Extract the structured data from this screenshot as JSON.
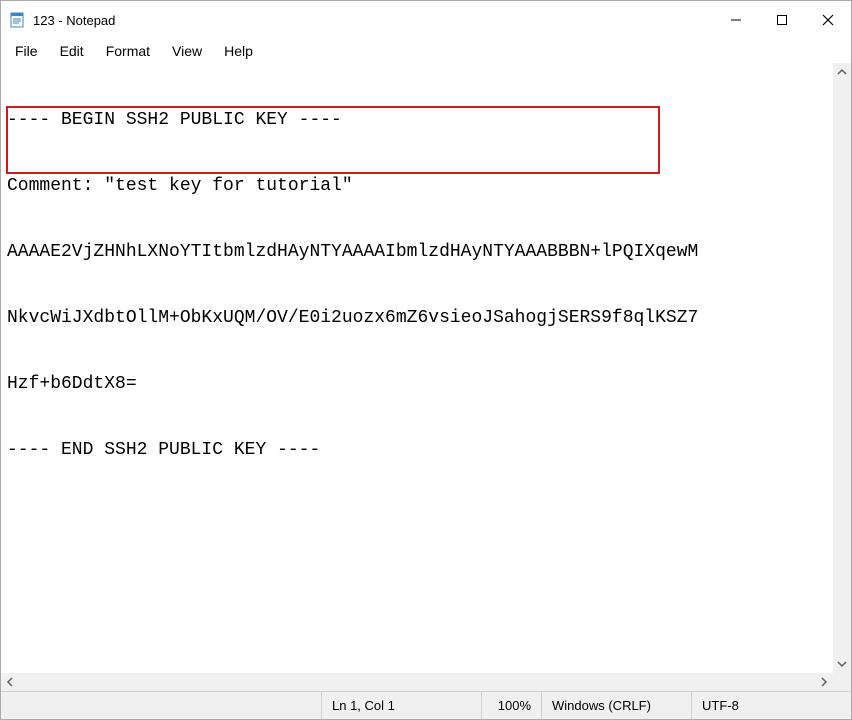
{
  "window": {
    "title": "123 - Notepad"
  },
  "menu": {
    "file": "File",
    "edit": "Edit",
    "format": "Format",
    "view": "View",
    "help": "Help"
  },
  "document": {
    "lines": [
      "---- BEGIN SSH2 PUBLIC KEY ----",
      "Comment: \"test key for tutorial\"",
      "AAAAE2VjZHNhLXNoYTItbmlzdHAyNTYAAAAIbmlzdHAyNTYAAABBBN+lPQIXqewM",
      "NkvcWiJXdbtOllM+ObKxUQM/OV/E0i2uozx6mZ6vsieoJSahogjSERS9f8qlKSZ7",
      "Hzf+b6DdtX8=",
      "---- END SSH2 PUBLIC KEY ----"
    ]
  },
  "status": {
    "position": "Ln 1, Col 1",
    "zoom": "100%",
    "line_ending": "Windows (CRLF)",
    "encoding": "UTF-8"
  }
}
